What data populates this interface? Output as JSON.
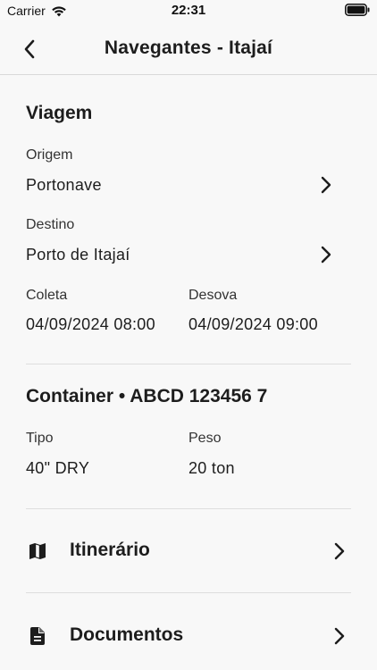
{
  "status_bar": {
    "carrier": "Carrier",
    "time": "22:31",
    "icons": [
      "wifi-icon",
      "battery-icon"
    ]
  },
  "nav": {
    "title": "Navegantes - Itajaí",
    "back_icon": "chevron-left-icon"
  },
  "viagem": {
    "title": "Viagem",
    "origem_label": "Origem",
    "origem_value": "Portonave",
    "destino_label": "Destino",
    "destino_value": "Porto de Itajaí",
    "coleta_label": "Coleta",
    "coleta_value": "04/09/2024 08:00",
    "desova_label": "Desova",
    "desova_value": "04/09/2024 09:00"
  },
  "container": {
    "title": "Container • ABCD 123456 7",
    "tipo_label": "Tipo",
    "tipo_value": "40\" DRY",
    "peso_label": "Peso",
    "peso_value": "20 ton"
  },
  "links": [
    {
      "label": "Itinerário",
      "icon": "map-icon"
    },
    {
      "label": "Documentos",
      "icon": "document-icon"
    }
  ],
  "colors": {
    "background": "#f8f8f8",
    "text": "#1d1d1d",
    "divider": "#dedede"
  }
}
